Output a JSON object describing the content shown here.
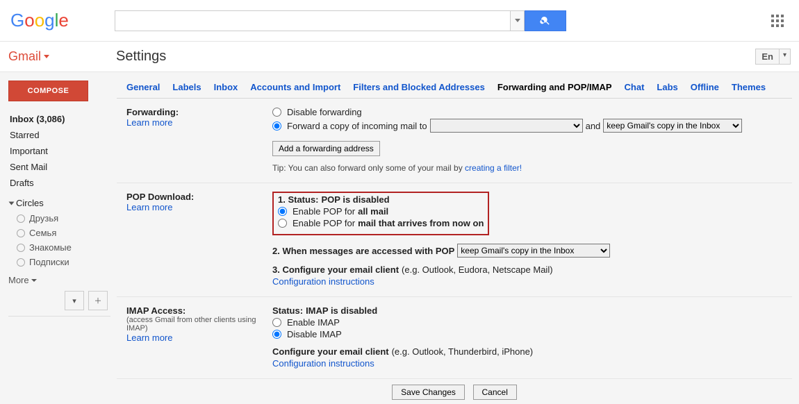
{
  "logo": "Google",
  "search": {
    "placeholder": ""
  },
  "app_dropdown": {
    "label": "Gmail"
  },
  "page_title": "Settings",
  "language_btn": "En",
  "compose": "COMPOSE",
  "sidebar": {
    "inbox": "Inbox (3,086)",
    "starred": "Starred",
    "important": "Important",
    "sent": "Sent Mail",
    "drafts": "Drafts",
    "circles": "Circles",
    "circle_items": [
      "Друзья",
      "Семья",
      "Знакомые",
      "Подписки"
    ],
    "more": "More"
  },
  "tabs": {
    "general": "General",
    "labels": "Labels",
    "inbox": "Inbox",
    "accounts": "Accounts and Import",
    "filters": "Filters and Blocked Addresses",
    "forwarding": "Forwarding and POP/IMAP",
    "chat": "Chat",
    "labs": "Labs",
    "offline": "Offline",
    "themes": "Themes"
  },
  "forwarding": {
    "title": "Forwarding:",
    "learn": "Learn more",
    "disable": "Disable forwarding",
    "forward_copy": "Forward a copy of incoming mail to",
    "and": "and",
    "keep_option": "keep Gmail's copy in the Inbox",
    "add_btn": "Add a forwarding address",
    "tip_pre": "Tip: You can also forward only some of your mail by ",
    "tip_link": "creating a filter!"
  },
  "pop": {
    "title": "POP Download:",
    "learn": "Learn more",
    "status_num": "1. Status: ",
    "status_val": "POP is disabled",
    "enable_all_pre": "Enable POP for ",
    "enable_all_bold": "all mail",
    "enable_now_pre": "Enable POP for ",
    "enable_now_bold": "mail that arrives from now on",
    "when": "2. When messages are accessed with POP",
    "keep_option": "keep Gmail's copy in the Inbox",
    "configure": "3. Configure your email client ",
    "configure_eg": "(e.g. Outlook, Eudora, Netscape Mail)",
    "instructions": "Configuration instructions"
  },
  "imap": {
    "title": "IMAP Access:",
    "note": "(access Gmail from other clients using IMAP)",
    "learn": "Learn more",
    "status": "Status: ",
    "status_val": "IMAP is disabled",
    "enable": "Enable IMAP",
    "disable": "Disable IMAP",
    "configure": "Configure your email client ",
    "configure_eg": "(e.g. Outlook, Thunderbird, iPhone)",
    "instructions": "Configuration instructions"
  },
  "buttons": {
    "save": "Save Changes",
    "cancel": "Cancel"
  }
}
